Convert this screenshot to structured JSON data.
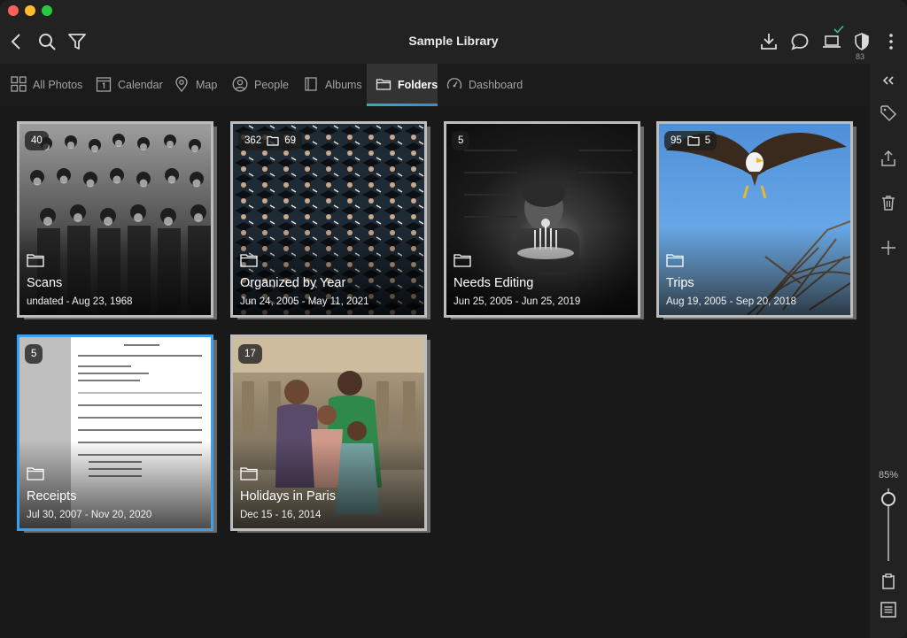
{
  "window": {
    "title": "Sample Library"
  },
  "toolbar": {
    "shield_count": "83"
  },
  "tabs": [
    {
      "label": "All Photos",
      "icon": "grid-icon"
    },
    {
      "label": "Calendar",
      "icon": "calendar-icon"
    },
    {
      "label": "Map",
      "icon": "map-pin-icon"
    },
    {
      "label": "People",
      "icon": "person-icon"
    },
    {
      "label": "Albums",
      "icon": "albums-icon"
    },
    {
      "label": "Folders",
      "icon": "folder-icon",
      "active": true
    },
    {
      "label": "Dashboard",
      "icon": "gauge-icon"
    }
  ],
  "folders": [
    {
      "title": "Scans",
      "dates": "undated - Aug 23, 1968",
      "badge_count": "40"
    },
    {
      "title": "Organized by Year",
      "dates": "Jun 24, 2005 - May 11, 2021",
      "badge_count": "362",
      "badge_folders": "69"
    },
    {
      "title": "Needs Editing",
      "dates": "Jun 25, 2005 - Jun 25, 2019",
      "badge_count": "5"
    },
    {
      "title": "Trips",
      "dates": "Aug 19, 2005 - Sep 20, 2018",
      "badge_count": "95",
      "badge_folders": "5"
    },
    {
      "title": "Receipts",
      "dates": "Jul 30, 2007 - Nov 20, 2020",
      "badge_count": "5",
      "selected": true
    },
    {
      "title": "Holidays in Paris",
      "dates": "Dec 15 - 16, 2014",
      "badge_count": "17"
    }
  ],
  "sidebar": {
    "zoom_label": "85%",
    "zoom_value": 0.85
  },
  "colors": {
    "accent": "#3aa0ee",
    "tab_underline": "#28b7a6"
  }
}
